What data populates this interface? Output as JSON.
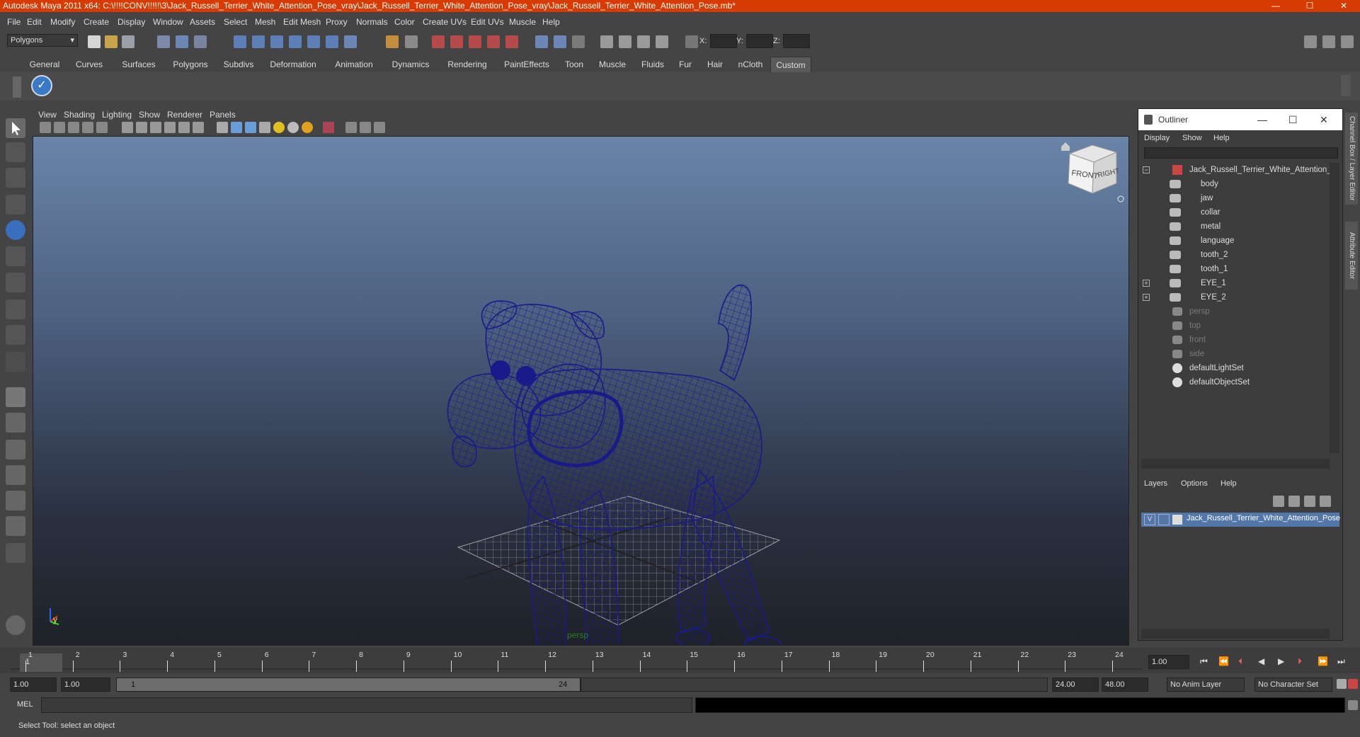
{
  "window": {
    "title": "Autodesk Maya 2011 x64: C:\\!!!!CONV!!!!!\\3\\Jack_Russell_Terrier_White_Attention_Pose_vray\\Jack_Russell_Terrier_White_Attention_Pose_vray\\Jack_Russell_Terrier_White_Attention_Pose.mb*",
    "minimize": "—",
    "maximize": "☐",
    "close": "✕"
  },
  "menubar": [
    "File",
    "Edit",
    "Modify",
    "Create",
    "Display",
    "Window",
    "Assets",
    "Select",
    "Mesh",
    "Edit Mesh",
    "Proxy",
    "Normals",
    "Color",
    "Create UVs",
    "Edit UVs",
    "Muscle",
    "Help"
  ],
  "statusline": {
    "mode": "Polygons",
    "x_label": "X:",
    "y_label": "Y:",
    "z_label": "Z:"
  },
  "shelf_tabs": [
    "General",
    "Curves",
    "Surfaces",
    "Polygons",
    "Subdivs",
    "Deformation",
    "Animation",
    "Dynamics",
    "Rendering",
    "PaintEffects",
    "Toon",
    "Muscle",
    "Fluids",
    "Fur",
    "Hair",
    "nCloth",
    "Custom"
  ],
  "shelf_active": "Custom",
  "viewport": {
    "menu": [
      "View",
      "Shading",
      "Lighting",
      "Show",
      "Renderer",
      "Panels"
    ],
    "camera_label": "persp",
    "viewcube_front": "FRONT",
    "viewcube_right": "RIGHT",
    "axis_y": "y"
  },
  "outliner": {
    "title": "Outliner",
    "menu": [
      "Display",
      "Show",
      "Help"
    ],
    "items": [
      {
        "label": "Jack_Russell_Terrier_White_Attention_P",
        "dim": false,
        "depth": 0,
        "expand": "minus",
        "icon": "group"
      },
      {
        "label": "body",
        "dim": false,
        "depth": 1,
        "icon": "mesh"
      },
      {
        "label": "jaw",
        "dim": false,
        "depth": 1,
        "icon": "mesh"
      },
      {
        "label": "collar",
        "dim": false,
        "depth": 1,
        "icon": "mesh"
      },
      {
        "label": "metal",
        "dim": false,
        "depth": 1,
        "icon": "mesh"
      },
      {
        "label": "language",
        "dim": false,
        "depth": 1,
        "icon": "mesh"
      },
      {
        "label": "tooth_2",
        "dim": false,
        "depth": 1,
        "icon": "mesh"
      },
      {
        "label": "tooth_1",
        "dim": false,
        "depth": 1,
        "icon": "mesh"
      },
      {
        "label": "EYE_1",
        "dim": false,
        "depth": 1,
        "expand": "plus",
        "icon": "mesh"
      },
      {
        "label": "EYE_2",
        "dim": false,
        "depth": 1,
        "expand": "plus",
        "icon": "mesh"
      },
      {
        "label": "persp",
        "dim": true,
        "depth": 0,
        "icon": "camera"
      },
      {
        "label": "top",
        "dim": true,
        "depth": 0,
        "icon": "camera"
      },
      {
        "label": "front",
        "dim": true,
        "depth": 0,
        "icon": "camera"
      },
      {
        "label": "side",
        "dim": true,
        "depth": 0,
        "icon": "camera"
      },
      {
        "label": "defaultLightSet",
        "dim": false,
        "depth": 0,
        "icon": "set"
      },
      {
        "label": "defaultObjectSet",
        "dim": false,
        "depth": 0,
        "icon": "set"
      }
    ]
  },
  "layers": {
    "menu": [
      "Layers",
      "Options",
      "Help"
    ],
    "layer_v": "V",
    "layer_name": "Jack_Russell_Terrier_White_Attention_Pose"
  },
  "side_tabs": [
    "Channel Box / Layer Editor",
    "Attribute Editor"
  ],
  "timeslider": {
    "ticks": [
      "1",
      "2",
      "3",
      "4",
      "5",
      "6",
      "7",
      "8",
      "9",
      "10",
      "11",
      "12",
      "13",
      "14",
      "15",
      "16",
      "17",
      "18",
      "19",
      "20",
      "21",
      "22",
      "23",
      "24"
    ],
    "current": "1",
    "current_frame_field": "1.00"
  },
  "range": {
    "start": "1.00",
    "playback_start": "1.00",
    "range_start_label": "1",
    "range_end_label": "24",
    "playback_end": "24.00",
    "end": "48.00",
    "anim_layer": "No Anim Layer",
    "character_set": "No Character Set"
  },
  "cmdline": {
    "label": "MEL"
  },
  "helpline": {
    "text": "Select Tool: select an object"
  },
  "colors": {
    "title_bar": "#d83b01",
    "wireframe": "#1a1a8a",
    "panel": "#444444"
  }
}
